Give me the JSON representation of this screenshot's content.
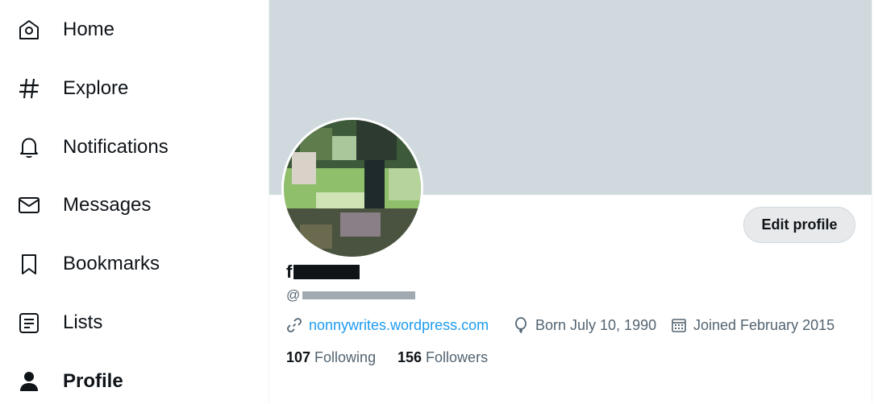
{
  "nav": {
    "home": "Home",
    "explore": "Explore",
    "notifications": "Notifications",
    "messages": "Messages",
    "bookmarks": "Bookmarks",
    "lists": "Lists",
    "profile": "Profile"
  },
  "profile": {
    "edit_button": "Edit profile",
    "display_name_visible": "f",
    "handle_prefix": "@",
    "website": "nonnywrites.wordpress.com",
    "born": "Born July 10, 1990",
    "joined": "Joined February 2015",
    "following_count": "107",
    "following_label": "Following",
    "followers_count": "156",
    "followers_label": "Followers"
  },
  "colors": {
    "banner": "#cfd9de",
    "accent_link": "#1d9bf0",
    "text_primary": "#0f1419",
    "text_secondary": "#536471"
  },
  "icons": [
    "home-icon",
    "explore-hashtag-icon",
    "notifications-bell-icon",
    "messages-envelope-icon",
    "bookmark-icon",
    "lists-icon",
    "profile-person-icon",
    "link-icon",
    "birthday-balloon-icon",
    "calendar-icon"
  ]
}
